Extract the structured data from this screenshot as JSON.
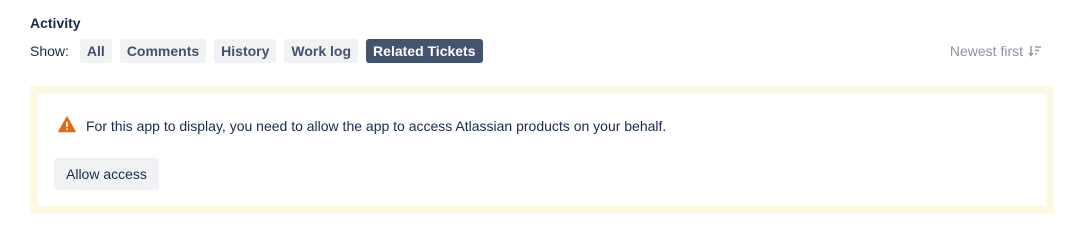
{
  "activity": {
    "heading": "Activity",
    "show_label": "Show:",
    "filters": [
      {
        "label": "All",
        "selected": false
      },
      {
        "label": "Comments",
        "selected": false
      },
      {
        "label": "History",
        "selected": false
      },
      {
        "label": "Work log",
        "selected": false
      },
      {
        "label": "Related Tickets",
        "selected": true
      }
    ],
    "sort": {
      "label": "Newest first",
      "icon": "sort-descending-icon"
    }
  },
  "banner": {
    "icon": "warning-icon",
    "message": "For this app to display, you need to allow the app to access Atlassian products on your behalf.",
    "button_label": "Allow access",
    "colors": {
      "background": "#fdf8e4",
      "warning": "#e56910"
    }
  },
  "colors": {
    "selected_filter_bg": "#44546f",
    "filter_bg": "#f1f2f4",
    "text": "#172b4d",
    "muted": "#8993a4"
  }
}
